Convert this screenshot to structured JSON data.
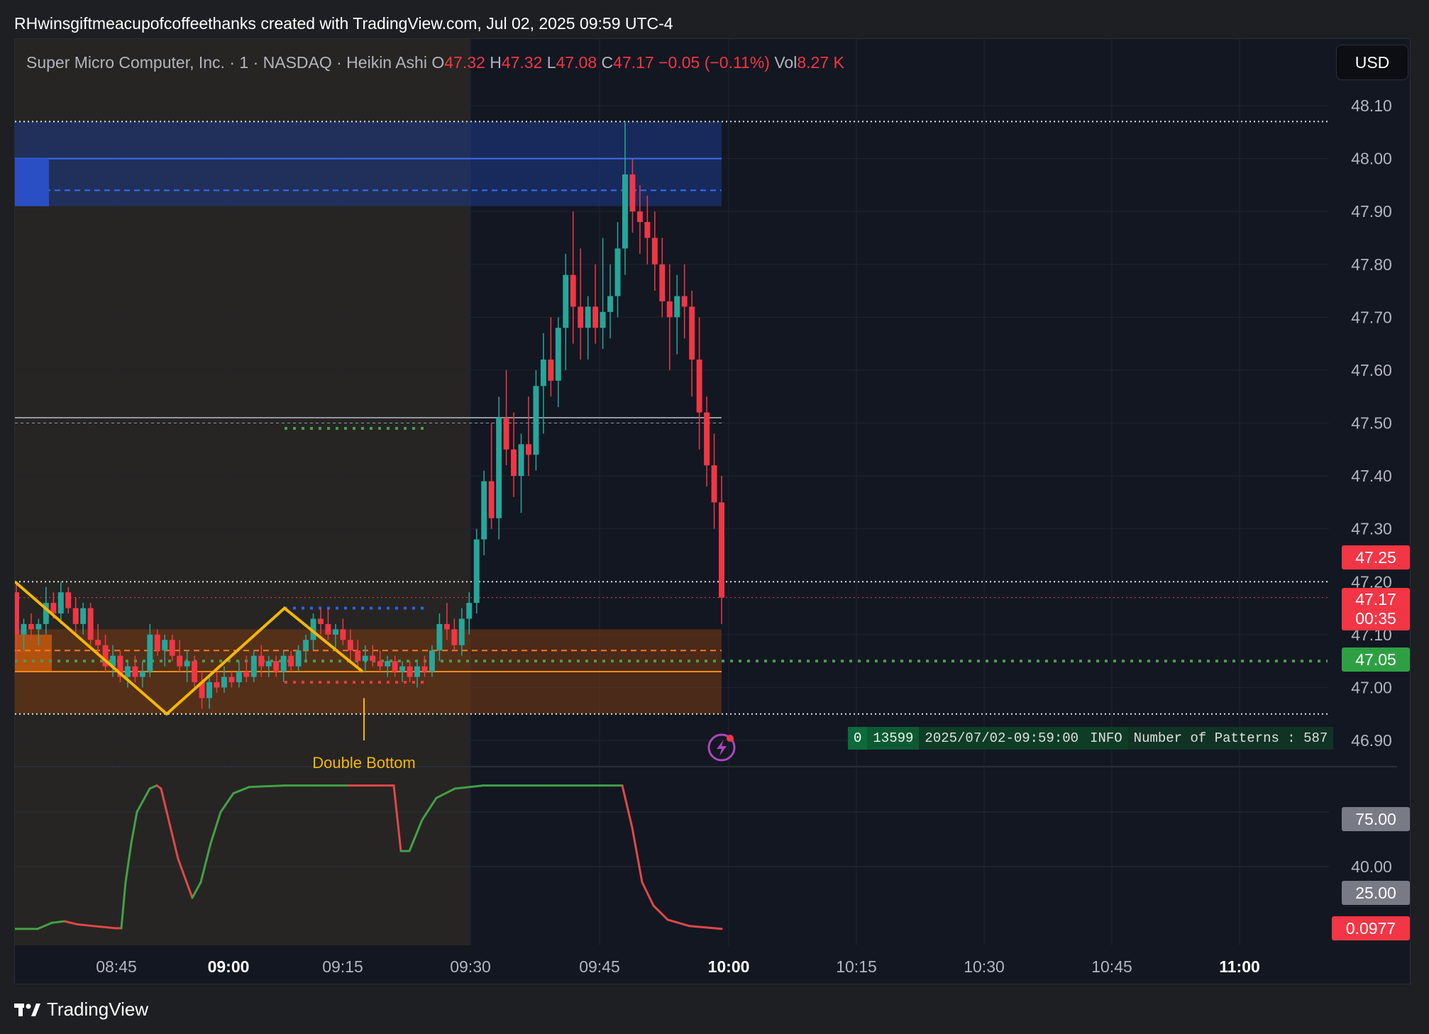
{
  "attribution": "RHwinsgiftmeacupofcoffeethanks created with TradingView.com, Jul 02, 2025 09:59 UTC-4",
  "legend": {
    "symbol": "Super Micro Computer, Inc. · 1 · NASDAQ · Heikin Ashi",
    "o_label": "O",
    "o": "47.32",
    "h_label": "H",
    "h": "47.32",
    "l_label": "L",
    "l": "47.08",
    "c_label": "C",
    "c": "47.17",
    "change": "−0.05 (−0.11%)",
    "vol_label": "Vol",
    "vol": "8.27 K"
  },
  "currency": "USD",
  "price_tags": {
    "upper": "47.25",
    "last": "47.17",
    "countdown": "00:35",
    "support": "47.05",
    "osc_75": "75.00",
    "osc_25": "25.00",
    "osc_last": "0.0977"
  },
  "pattern_label": "Double Bottom",
  "info_box": [
    "0",
    "13599",
    "2025/07/02-09:59:00",
    "INFO",
    "Number of Patterns : 587"
  ],
  "footer": "TradingView",
  "colors": {
    "up": "#26a69a",
    "down": "#f23645",
    "zigzag": "#f5b700",
    "supply_zone": "#1e3a8a",
    "demand_zone": "#7a3a12",
    "osc_up": "#43a047",
    "osc_down": "#e04848"
  },
  "chart_data": {
    "type": "candlestick",
    "symbol": "Super Micro Computer, Inc.",
    "interval": "1",
    "exchange": "NASDAQ",
    "style": "Heikin Ashi",
    "price_axis": {
      "min": 46.9,
      "max": 48.1,
      "ticks": [
        "48.10",
        "48.00",
        "47.90",
        "47.80",
        "47.70",
        "47.60",
        "47.50",
        "47.40",
        "47.30",
        "47.20",
        "47.10",
        "47.00",
        "46.90"
      ]
    },
    "time_axis": {
      "ticks": [
        "08:45",
        "09:00",
        "09:15",
        "09:30",
        "09:45",
        "10:00",
        "10:15",
        "10:30",
        "10:45",
        "11:00"
      ],
      "bold": [
        "09:00",
        "10:00",
        "11:00"
      ]
    },
    "oscillator_axis": {
      "ticks": [
        "40.00"
      ],
      "tags": [
        "75.00",
        "25.00",
        "0.0977"
      ]
    },
    "zones": [
      {
        "kind": "supply",
        "top": 48.07,
        "bottom": 47.91,
        "mid": 47.94
      },
      {
        "kind": "demand",
        "top": 47.11,
        "bottom": 46.95
      }
    ],
    "levels": [
      47.51,
      47.5,
      47.2,
      47.17,
      47.05,
      47.03,
      46.95,
      48.07
    ],
    "pattern": "Double Bottom",
    "candles": [
      [
        47.18,
        47.2,
        47.05,
        47.1
      ],
      [
        47.1,
        47.13,
        47.07,
        47.12
      ],
      [
        47.12,
        47.14,
        47.09,
        47.11
      ],
      [
        47.11,
        47.13,
        47.08,
        47.12
      ],
      [
        47.12,
        47.19,
        47.1,
        47.16
      ],
      [
        47.16,
        47.18,
        47.13,
        47.14
      ],
      [
        47.14,
        47.2,
        47.12,
        47.18
      ],
      [
        47.18,
        47.19,
        47.14,
        47.15
      ],
      [
        47.15,
        47.17,
        47.1,
        47.12
      ],
      [
        47.12,
        47.16,
        47.1,
        47.15
      ],
      [
        47.15,
        47.16,
        47.08,
        47.09
      ],
      [
        47.09,
        47.12,
        47.06,
        47.08
      ],
      [
        47.08,
        47.1,
        47.03,
        47.04
      ],
      [
        47.04,
        47.08,
        47.02,
        47.06
      ],
      [
        47.06,
        47.07,
        47.01,
        47.02
      ],
      [
        47.02,
        47.05,
        47.0,
        47.04
      ],
      [
        47.04,
        47.06,
        47.01,
        47.02
      ],
      [
        47.02,
        47.05,
        47.0,
        47.03
      ],
      [
        47.03,
        47.12,
        47.02,
        47.1
      ],
      [
        47.1,
        47.11,
        47.06,
        47.07
      ],
      [
        47.07,
        47.1,
        47.04,
        47.09
      ],
      [
        47.09,
        47.1,
        47.05,
        47.06
      ],
      [
        47.06,
        47.09,
        47.03,
        47.04
      ],
      [
        47.04,
        47.07,
        47.01,
        47.05
      ],
      [
        47.05,
        47.06,
        47.0,
        47.01
      ],
      [
        47.01,
        47.03,
        46.96,
        46.98
      ],
      [
        46.98,
        47.02,
        46.96,
        47.01
      ],
      [
        47.01,
        47.03,
        46.99,
        47.0
      ],
      [
        47.0,
        47.04,
        46.99,
        47.02
      ],
      [
        47.02,
        47.03,
        47.0,
        47.01
      ],
      [
        47.01,
        47.05,
        47.0,
        47.03
      ],
      [
        47.03,
        47.06,
        47.01,
        47.02
      ],
      [
        47.02,
        47.07,
        47.01,
        47.06
      ],
      [
        47.06,
        47.08,
        47.02,
        47.04
      ],
      [
        47.04,
        47.06,
        47.02,
        47.05
      ],
      [
        47.05,
        47.06,
        47.02,
        47.03
      ],
      [
        47.03,
        47.07,
        47.01,
        47.06
      ],
      [
        47.06,
        47.07,
        47.03,
        47.04
      ],
      [
        47.04,
        47.08,
        47.03,
        47.07
      ],
      [
        47.07,
        47.1,
        47.05,
        47.09
      ],
      [
        47.09,
        47.14,
        47.07,
        47.13
      ],
      [
        47.13,
        47.15,
        47.1,
        47.12
      ],
      [
        47.12,
        47.15,
        47.09,
        47.1
      ],
      [
        47.1,
        47.12,
        47.07,
        47.11
      ],
      [
        47.11,
        47.13,
        47.08,
        47.09
      ],
      [
        47.09,
        47.11,
        47.05,
        47.07
      ],
      [
        47.07,
        47.09,
        47.04,
        47.05
      ],
      [
        47.05,
        47.08,
        47.03,
        47.06
      ],
      [
        47.06,
        47.08,
        47.04,
        47.05
      ],
      [
        47.05,
        47.07,
        47.03,
        47.04
      ],
      [
        47.04,
        47.06,
        47.02,
        47.05
      ],
      [
        47.05,
        47.06,
        47.02,
        47.03
      ],
      [
        47.03,
        47.05,
        47.01,
        47.04
      ],
      [
        47.04,
        47.05,
        47.01,
        47.02
      ],
      [
        47.02,
        47.05,
        47.0,
        47.04
      ],
      [
        47.04,
        47.06,
        47.02,
        47.03
      ],
      [
        47.03,
        47.08,
        47.02,
        47.07
      ],
      [
        47.07,
        47.14,
        47.05,
        47.12
      ],
      [
        47.12,
        47.16,
        47.09,
        47.11
      ],
      [
        47.11,
        47.13,
        47.07,
        47.08
      ],
      [
        47.08,
        47.15,
        47.06,
        47.13
      ],
      [
        47.13,
        47.18,
        47.1,
        47.16
      ],
      [
        47.16,
        47.3,
        47.14,
        47.28
      ],
      [
        47.28,
        47.41,
        47.25,
        47.39
      ],
      [
        47.39,
        47.5,
        47.3,
        47.32
      ],
      [
        47.32,
        47.55,
        47.28,
        47.51
      ],
      [
        47.51,
        47.6,
        47.42,
        47.45
      ],
      [
        47.45,
        47.52,
        47.36,
        47.4
      ],
      [
        47.4,
        47.48,
        47.33,
        47.46
      ],
      [
        47.46,
        47.55,
        47.4,
        47.44
      ],
      [
        47.44,
        47.6,
        47.41,
        47.57
      ],
      [
        47.57,
        47.67,
        47.48,
        47.62
      ],
      [
        47.62,
        47.7,
        47.55,
        47.58
      ],
      [
        47.58,
        47.7,
        47.53,
        47.68
      ],
      [
        47.68,
        47.82,
        47.6,
        47.78
      ],
      [
        47.78,
        47.9,
        47.65,
        47.72
      ],
      [
        47.72,
        47.83,
        47.62,
        47.68
      ],
      [
        47.68,
        47.74,
        47.62,
        47.72
      ],
      [
        47.72,
        47.8,
        47.65,
        47.68
      ],
      [
        47.68,
        47.85,
        47.64,
        47.71
      ],
      [
        47.71,
        47.8,
        47.66,
        47.74
      ],
      [
        47.74,
        47.88,
        47.7,
        47.83
      ],
      [
        47.83,
        48.07,
        47.78,
        47.97
      ],
      [
        47.97,
        48.0,
        47.86,
        47.9
      ],
      [
        47.9,
        47.95,
        47.82,
        47.88
      ],
      [
        47.88,
        47.93,
        47.8,
        47.85
      ],
      [
        47.85,
        47.9,
        47.75,
        47.8
      ],
      [
        47.8,
        47.85,
        47.7,
        47.73
      ],
      [
        47.73,
        47.8,
        47.6,
        47.7
      ],
      [
        47.7,
        47.78,
        47.63,
        47.74
      ],
      [
        47.74,
        47.8,
        47.66,
        47.72
      ],
      [
        47.72,
        47.75,
        47.55,
        47.62
      ],
      [
        47.62,
        47.7,
        47.45,
        47.52
      ],
      [
        47.52,
        47.55,
        47.38,
        47.42
      ],
      [
        47.42,
        47.48,
        47.3,
        47.35
      ],
      [
        47.35,
        47.4,
        47.12,
        47.17
      ]
    ],
    "oscillator_levels": [
      75,
      40,
      25,
      0.0977
    ]
  }
}
